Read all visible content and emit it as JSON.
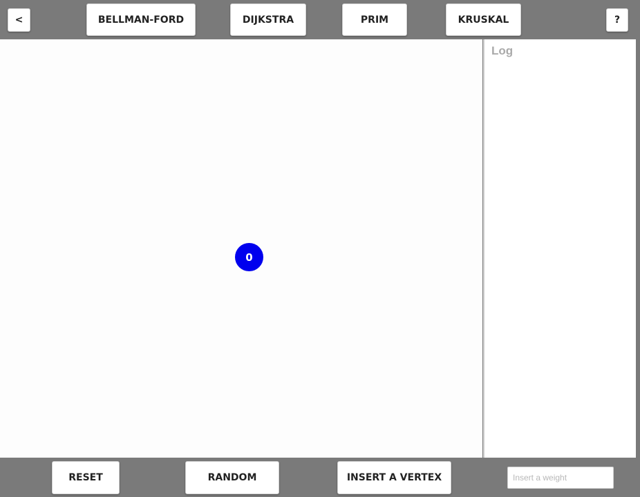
{
  "toolbar": {
    "back_label": "<",
    "algorithms": {
      "bellman_ford": "BELLMAN-FORD",
      "dijkstra": "DIJKSTRA",
      "prim": "PRIM",
      "kruskal": "KRUSKAL"
    },
    "help_label": "?"
  },
  "graph": {
    "vertices": [
      {
        "label": "0",
        "color": "#0000ee"
      }
    ]
  },
  "log": {
    "title": "Log"
  },
  "controls": {
    "reset_label": "RESET",
    "random_label": "RANDOM",
    "insert_vertex_label": "INSERT A VERTEX",
    "weight_placeholder": "Insert a weight",
    "weight_value": ""
  },
  "colors": {
    "toolbar_background": "#7a7a7a",
    "canvas_background": "#fdfdfd",
    "vertex_fill": "#0000ee",
    "log_title": "#aaaaaa"
  }
}
